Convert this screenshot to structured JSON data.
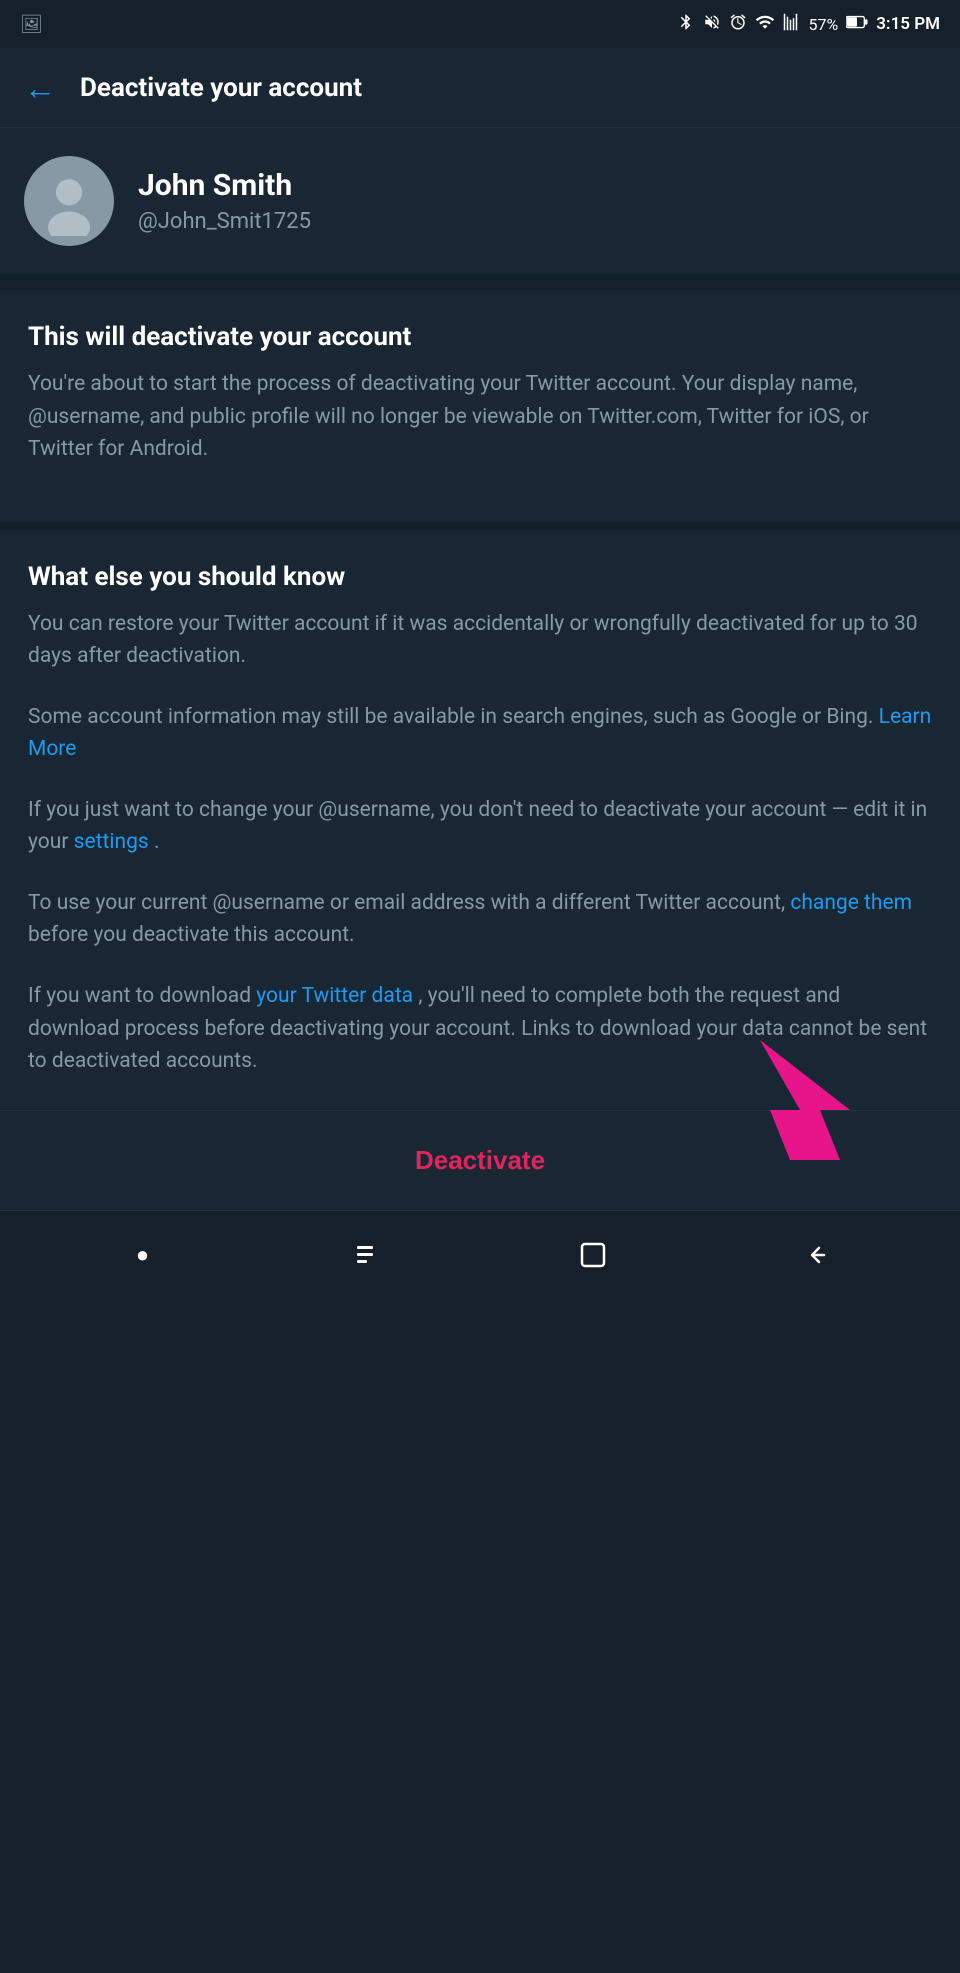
{
  "statusBar": {
    "leftIcon": "📷",
    "bluetooth": "bluetooth",
    "mute": "mute",
    "alarm": "alarm",
    "wifi": "wifi",
    "signal": "signal",
    "battery": "57%",
    "time": "3:15 PM"
  },
  "header": {
    "backLabel": "←",
    "title": "Deactivate your account"
  },
  "profile": {
    "name": "John Smith",
    "username": "@John_Smit1725"
  },
  "deactivateSection": {
    "title": "This will deactivate your account",
    "body": "You're about to start the process of deactivating your Twitter account. Your display name, @username, and public profile will no longer be viewable on Twitter.com, Twitter for iOS, or Twitter for Android."
  },
  "knowSection": {
    "title": "What else you should know",
    "restore_text": "You can restore your Twitter account if it was accidentally or wrongfully deactivated for up to 30 days after deactivation.",
    "search_text_before": "Some account information may still be available in search engines, such as Google or Bing.",
    "learn_more": "Learn More",
    "username_change_before": "If you just want to change your @username, you don't need to deactivate your account — edit it in your",
    "settings_link": "settings",
    "username_change_after": ".",
    "email_before": "To use your current @username or email address with a different Twitter account,",
    "change_them_link": "change them",
    "email_after": "before you deactivate this account.",
    "data_before": "If you want to download",
    "twitter_data_link": "your Twitter data",
    "data_after": ", you'll need to complete both the request and download process before deactivating your account. Links to download your data cannot be sent to deactivated accounts."
  },
  "footer": {
    "deactivate_label": "Deactivate"
  },
  "navBar": {
    "home": "●",
    "recent": "⊢",
    "square": "▢",
    "back": "←"
  }
}
